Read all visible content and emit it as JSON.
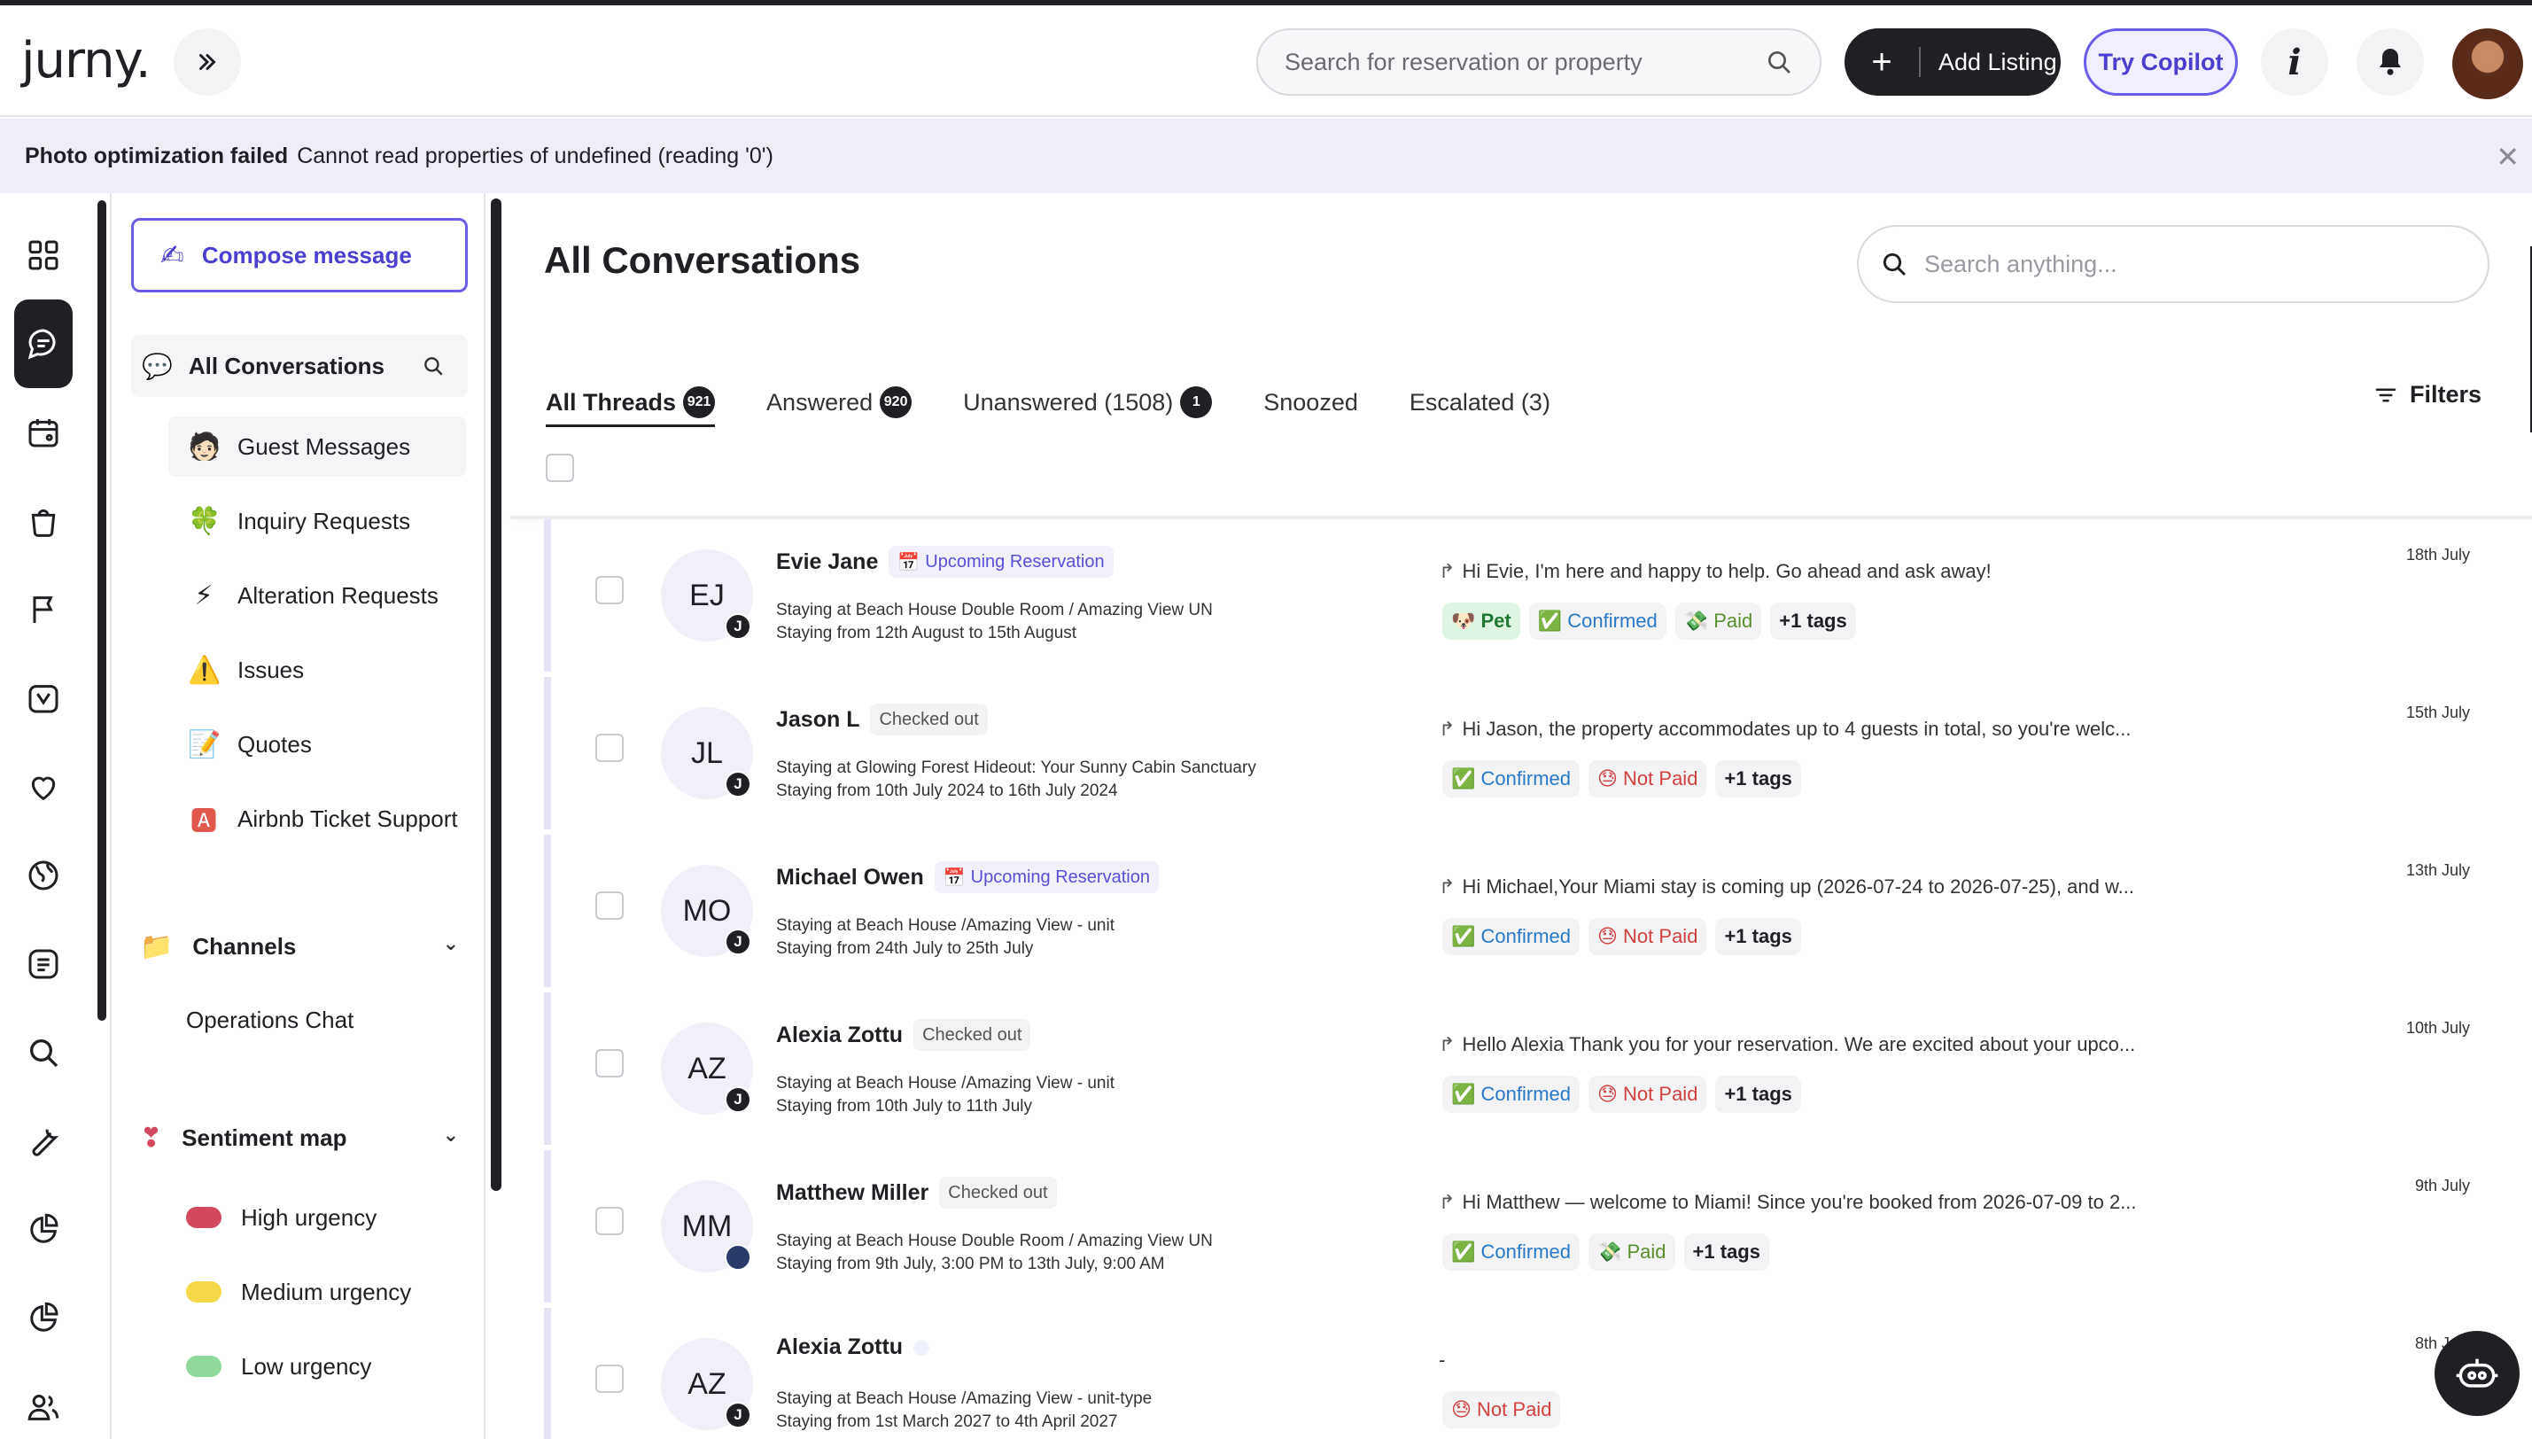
{
  "header": {
    "logo": "jurny.",
    "search_placeholder": "Search for reservation or property",
    "add_listing": "Add Listing",
    "copilot": "Try Copilot"
  },
  "banner": {
    "title": "Photo optimization failed",
    "message": "Cannot read properties of undefined (reading '0')"
  },
  "rail": {
    "icons": [
      "grid-icon",
      "chat-icon",
      "calendar-icon",
      "bag-icon",
      "flag-icon",
      "calendar-star-icon",
      "heart-icon",
      "globe-icon",
      "list-icon",
      "search-icon",
      "wrench-icon",
      "pie-chart-icon",
      "pie-chart-icon",
      "users-icon"
    ]
  },
  "sidebar": {
    "compose": "Compose message",
    "all_conversations": "All Conversations",
    "items": [
      {
        "label": "Guest Messages",
        "emoji": "🧑🏻"
      },
      {
        "label": "Inquiry Requests",
        "emoji": "🍀"
      },
      {
        "label": "Alteration Requests",
        "emoji": "⚡"
      },
      {
        "label": "Issues",
        "emoji": "⚠️"
      },
      {
        "label": "Quotes",
        "emoji": "📝"
      },
      {
        "label": "Airbnb Ticket Support",
        "emoji": "🅰"
      }
    ],
    "channels": "Channels",
    "operations_chat": "Operations Chat",
    "sentiment_map": "Sentiment map",
    "urgency": [
      {
        "label": "High urgency",
        "color": "#d2485f"
      },
      {
        "label": "Medium urgency",
        "color": "#f5d84a"
      },
      {
        "label": "Low urgency",
        "color": "#8fd99c"
      }
    ]
  },
  "main": {
    "title": "All Conversations",
    "search_placeholder": "Search anything...",
    "filters": "Filters",
    "tabs": [
      {
        "label": "All Threads",
        "badge": "921"
      },
      {
        "label": "Answered",
        "badge": "920"
      },
      {
        "label": "Unanswered (1508)",
        "badge": "1"
      },
      {
        "label": "Snoozed",
        "badge": ""
      },
      {
        "label": "Escalated (3)",
        "badge": ""
      }
    ],
    "threads": [
      {
        "initials": "EJ",
        "name": "Evie Jane",
        "status": "Upcoming Reservation",
        "line1": "Staying at Beach House Double Room / Amazing View UN",
        "line2": "Staying from 12th August to 15th August",
        "message": "Hi Evie, I'm here and happy to help. Go ahead and ask away!",
        "date": "18th July",
        "tags": [
          "🐶 Pet",
          "✅ Confirmed",
          "💸 Paid",
          "+1 tags"
        ]
      },
      {
        "initials": "JL",
        "name": "Jason L",
        "status": "Checked out",
        "line1": "Staying at Glowing Forest Hideout: Your Sunny Cabin Sanctuary",
        "line2": "Staying from 10th July 2024 to 16th July 2024",
        "message": "Hi Jason, the property accommodates up to 4 guests in total, so you're welc...",
        "date": "15th July",
        "tags": [
          "✅ Confirmed",
          "😓 Not Paid",
          "+1 tags"
        ]
      },
      {
        "initials": "MO",
        "name": "Michael Owen",
        "status": "Upcoming Reservation",
        "line1": "Staying at Beach House /Amazing View - unit",
        "line2": "Staying from 24th July to 25th July",
        "message": "Hi Michael,Your Miami stay is coming up (2026-07-24 to 2026-07-25), and w...",
        "date": "13th July",
        "tags": [
          "✅ Confirmed",
          "😓 Not Paid",
          "+1 tags"
        ]
      },
      {
        "initials": "AZ",
        "name": "Alexia Zottu",
        "status": "Checked out",
        "line1": "Staying at Beach House /Amazing View - unit",
        "line2": "Staying from 10th July to 11th July",
        "message": "Hello Alexia Thank you for your reservation. We are excited about your upco...",
        "date": "10th July",
        "tags": [
          "✅ Confirmed",
          "😓 Not Paid",
          "+1 tags"
        ]
      },
      {
        "initials": "MM",
        "name": "Matthew Miller",
        "status": "Checked out",
        "line1": "Staying at Beach House Double Room / Amazing View UN",
        "line2": "Staying from 9th July, 3:00 PM to 13th July, 9:00 AM",
        "message": "Hi Matthew — welcome to Miami! Since you're booked from 2026-07-09 to 2...",
        "date": "9th July",
        "tags": [
          "✅ Confirmed",
          "💸 Paid",
          "+1 tags"
        ]
      },
      {
        "initials": "AZ",
        "name": "Alexia Zottu",
        "status": "",
        "line1": "Staying at Beach House /Amazing View - unit-type",
        "line2": "Staying from 1st March 2027 to 4th April 2027",
        "message": "-",
        "date": "8th July",
        "tags": [
          "😓 Not Paid"
        ]
      }
    ]
  }
}
